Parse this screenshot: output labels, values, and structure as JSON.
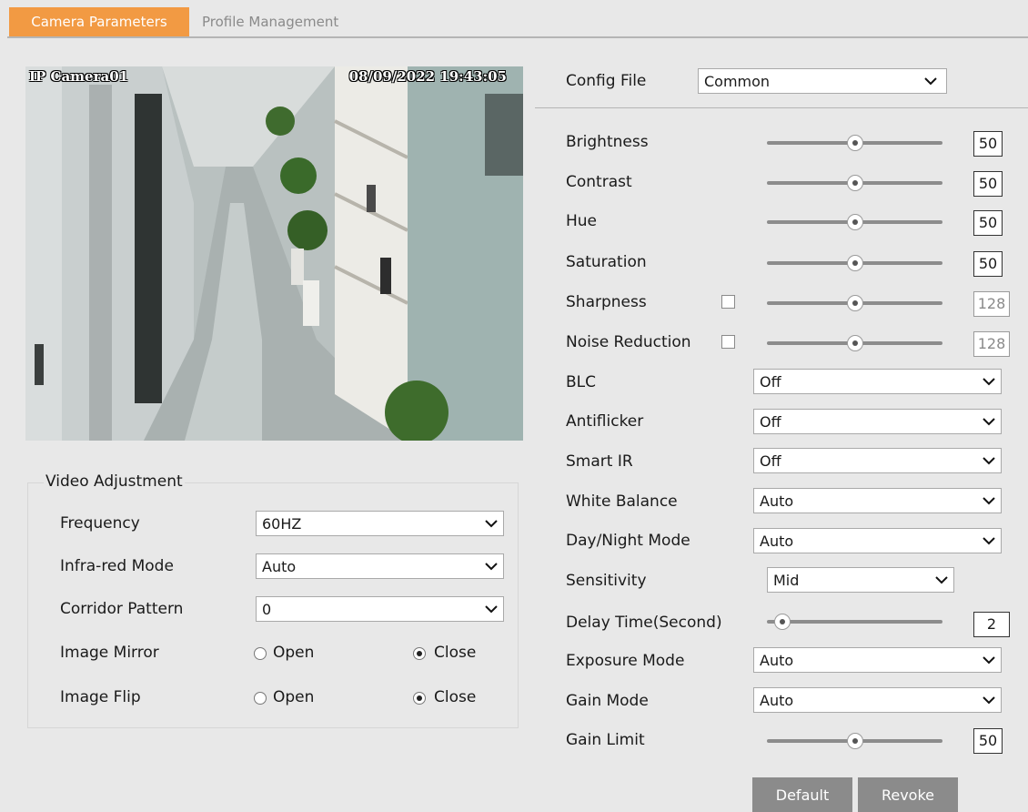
{
  "tabs": {
    "camera_parameters": "Camera Parameters",
    "profile_management": "Profile Management"
  },
  "preview": {
    "camera_name": "IP Camera01",
    "timestamp": "08/09/2022 19:43:05"
  },
  "video_adjustment": {
    "title": "Video Adjustment",
    "frequency": {
      "label": "Frequency",
      "value": "60HZ"
    },
    "infrared_mode": {
      "label": "Infra-red Mode",
      "value": "Auto"
    },
    "corridor_pattern": {
      "label": "Corridor Pattern",
      "value": "0"
    },
    "image_mirror": {
      "label": "Image Mirror",
      "open": "Open",
      "close": "Close",
      "selected": "Close"
    },
    "image_flip": {
      "label": "Image Flip",
      "open": "Open",
      "close": "Close",
      "selected": "Close"
    }
  },
  "config_file": {
    "label": "Config File",
    "value": "Common"
  },
  "sliders": {
    "brightness": {
      "label": "Brightness",
      "value": "50",
      "level": 0.5
    },
    "contrast": {
      "label": "Contrast",
      "value": "50",
      "level": 0.5
    },
    "hue": {
      "label": "Hue",
      "value": "50",
      "level": 0.5
    },
    "saturation": {
      "label": "Saturation",
      "value": "50",
      "level": 0.5
    },
    "sharpness": {
      "label": "Sharpness",
      "value": "128",
      "level": 0.5
    },
    "noise_reduction": {
      "label": "Noise Reduction",
      "value": "128",
      "level": 0.5
    },
    "delay_time": {
      "label": "Delay Time(Second)",
      "value": "2",
      "level": 0.0
    },
    "gain_limit": {
      "label": "Gain Limit",
      "value": "50",
      "level": 0.5
    }
  },
  "selects": {
    "blc": {
      "label": "BLC",
      "value": "Off"
    },
    "antiflicker": {
      "label": "Antiflicker",
      "value": "Off"
    },
    "smart_ir": {
      "label": "Smart IR",
      "value": "Off"
    },
    "white_balance": {
      "label": "White Balance",
      "value": "Auto"
    },
    "day_night_mode": {
      "label": "Day/Night Mode",
      "value": "Auto"
    },
    "sensitivity": {
      "label": "Sensitivity",
      "value": "Mid"
    },
    "exposure_mode": {
      "label": "Exposure Mode",
      "value": "Auto"
    },
    "gain_mode": {
      "label": "Gain Mode",
      "value": "Auto"
    }
  },
  "buttons": {
    "default": "Default",
    "revoke": "Revoke"
  },
  "colors": {
    "accent": "#f29a43",
    "button": "#8b8b8b",
    "background": "#e8e8e8"
  }
}
